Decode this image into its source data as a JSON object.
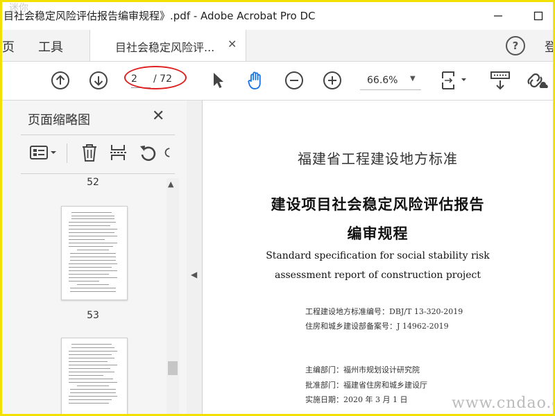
{
  "window": {
    "title": "目社会稳定风险评估报告编审规程》.pdf - Adobe Acrobat Pro DC",
    "watermark_top": "迷你"
  },
  "tabs": {
    "home_cut": "页",
    "tools": "工具",
    "document": "目社会稳定风险评...",
    "right_cut": "登"
  },
  "toolbar": {
    "current_page": "2",
    "total_pages": "/ 72",
    "zoom": "66.6%"
  },
  "thumbnails": {
    "title": "页面缩略图",
    "page_labels": [
      "52",
      "53"
    ]
  },
  "document": {
    "line1": "福建省工程建设地方标准",
    "line2": "建设项目社会稳定风险评估报告",
    "line3": "编审规程",
    "line4": "Standard specification for social stability risk",
    "line5": "assessment report of construction project",
    "code": "工程建设地方标准编号：DBJ/T 13-320-2019",
    "record": "住房和城乡建设部备案号：J 14962-2019",
    "editor": "主编部门：福州市规划设计研究院",
    "approver": "批准部门：福建省住房和城乡建设厅",
    "effective": "实施日期：2020 年 3 月 1 日"
  },
  "watermark": "www.cndao.com",
  "colors": {
    "accent": "#1473e6",
    "highlight_oval": "#e02020",
    "frame_border": "#f2e000"
  },
  "icons": [
    "page-up-icon",
    "page-down-icon",
    "select-arrow-icon",
    "hand-tool-icon",
    "zoom-out-icon",
    "zoom-in-icon",
    "fit-page-icon",
    "scroll-mode-icon",
    "share-link-icon",
    "thumbnail-options-icon",
    "delete-icon",
    "insert-page-icon",
    "rotate-ccw-icon",
    "rotate-cw-icon",
    "help-icon",
    "close-icon"
  ]
}
